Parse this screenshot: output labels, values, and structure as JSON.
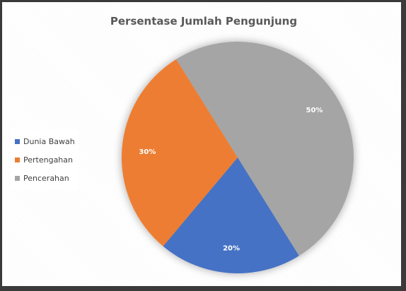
{
  "chart_data": {
    "type": "pie",
    "title": "Persentase Jumlah Pengunjung",
    "categories": [
      "Dunia Bawah",
      "Pertengahan",
      "Pencerahan"
    ],
    "values": [
      20,
      30,
      50
    ],
    "data_labels": [
      "20%",
      "30%",
      "50%"
    ],
    "colors": [
      "#4472C4",
      "#ED7D31",
      "#A5A5A5"
    ],
    "legend_position": "left",
    "start_angle_deg": 148
  }
}
